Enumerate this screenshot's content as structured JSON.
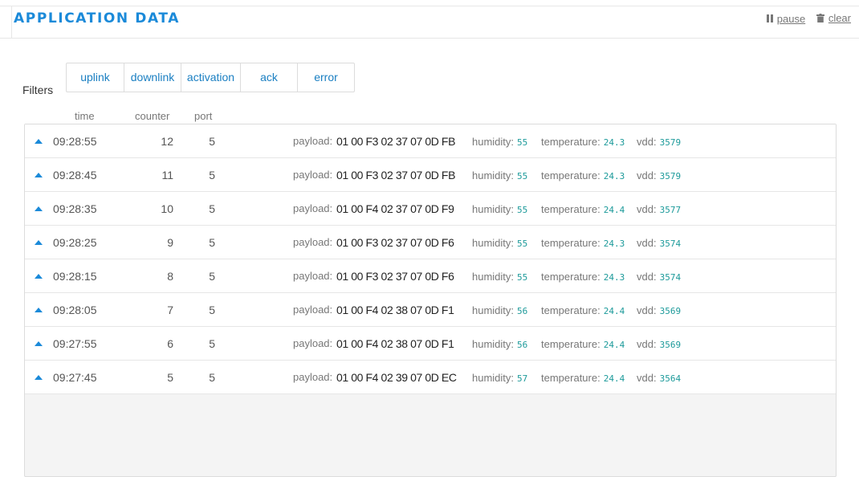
{
  "header": {
    "title": "APPLICATION DATA",
    "pause_label": "pause",
    "clear_label": "clear"
  },
  "filters": {
    "label": "Filters",
    "buttons": [
      "uplink",
      "downlink",
      "activation",
      "ack",
      "error"
    ]
  },
  "columns": {
    "time": "time",
    "counter": "counter",
    "port": "port"
  },
  "field_labels": {
    "payload": "payload:",
    "humidity": "humidity:",
    "temperature": "temperature:",
    "vdd": "vdd:"
  },
  "rows": [
    {
      "time": "09:28:55",
      "counter": "12",
      "port": "5",
      "payload": "01 00 F3 02 37 07 0D FB",
      "humidity": "55",
      "temperature": "24.3",
      "vdd": "3579"
    },
    {
      "time": "09:28:45",
      "counter": "11",
      "port": "5",
      "payload": "01 00 F3 02 37 07 0D FB",
      "humidity": "55",
      "temperature": "24.3",
      "vdd": "3579"
    },
    {
      "time": "09:28:35",
      "counter": "10",
      "port": "5",
      "payload": "01 00 F4 02 37 07 0D F9",
      "humidity": "55",
      "temperature": "24.4",
      "vdd": "3577"
    },
    {
      "time": "09:28:25",
      "counter": "9",
      "port": "5",
      "payload": "01 00 F3 02 37 07 0D F6",
      "humidity": "55",
      "temperature": "24.3",
      "vdd": "3574"
    },
    {
      "time": "09:28:15",
      "counter": "8",
      "port": "5",
      "payload": "01 00 F3 02 37 07 0D F6",
      "humidity": "55",
      "temperature": "24.3",
      "vdd": "3574"
    },
    {
      "time": "09:28:05",
      "counter": "7",
      "port": "5",
      "payload": "01 00 F4 02 38 07 0D F1",
      "humidity": "56",
      "temperature": "24.4",
      "vdd": "3569"
    },
    {
      "time": "09:27:55",
      "counter": "6",
      "port": "5",
      "payload": "01 00 F4 02 38 07 0D F1",
      "humidity": "56",
      "temperature": "24.4",
      "vdd": "3569"
    },
    {
      "time": "09:27:45",
      "counter": "5",
      "port": "5",
      "payload": "01 00 F4 02 39 07 0D EC",
      "humidity": "57",
      "temperature": "24.4",
      "vdd": "3564"
    }
  ],
  "icons": {
    "row_toggle": "caret-up-icon",
    "pause": "pause-icon",
    "clear": "trash-icon"
  },
  "colors": {
    "accent": "#1b8ad9",
    "link": "#1a7fc2",
    "value": "#1c9a9a"
  }
}
